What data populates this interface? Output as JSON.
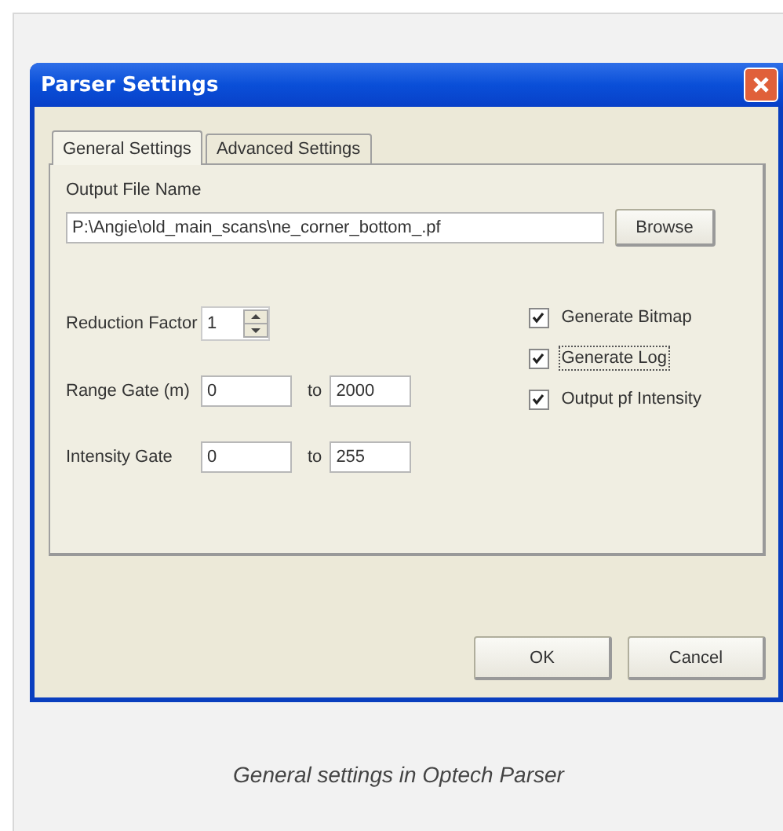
{
  "window": {
    "title": "Parser Settings"
  },
  "tabs": [
    {
      "label": "General Settings",
      "selected": true
    },
    {
      "label": "Advanced Settings",
      "selected": false
    }
  ],
  "output_file": {
    "label": "Output File Name",
    "value": "P:\\Angie\\old_main_scans\\ne_corner_bottom_.pf",
    "button": "Browse"
  },
  "reduction_factor": {
    "label": "Reduction Factor",
    "value": "1"
  },
  "range_gate": {
    "label": "Range Gate (m)",
    "from": "0",
    "separator": "to",
    "to": "2000"
  },
  "intensity_gate": {
    "label": "Intensity Gate",
    "from": "0",
    "separator": "to",
    "to": "255"
  },
  "options": [
    {
      "label": "Generate Bitmap",
      "checked": true,
      "focused": false
    },
    {
      "label": "Generate Log",
      "checked": true,
      "focused": true
    },
    {
      "label": "Output pf Intensity",
      "checked": true,
      "focused": false
    }
  ],
  "buttons": [
    "OK",
    "Cancel"
  ],
  "caption": "General settings in Optech Parser"
}
